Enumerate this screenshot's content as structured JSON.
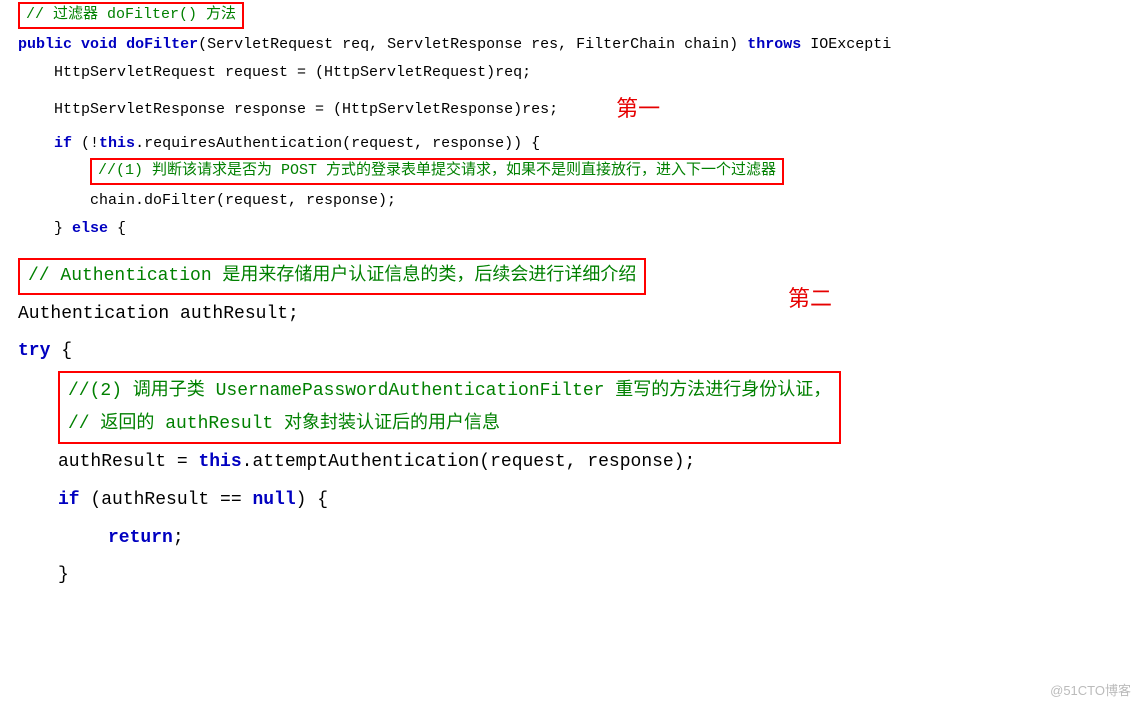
{
  "block1": {
    "c1": "// 过滤器 doFilter() 方法",
    "sig": {
      "pub": "public",
      "void": "void",
      "fn": "doFilter",
      "args": "(ServletRequest req, ServletResponse res, FilterChain chain)",
      "throws": "throws",
      "ex": "IOExcepti"
    },
    "l1a": "HttpServletRequest request = (HttpServletRequest)req;",
    "l1b": "HttpServletResponse response = (HttpServletResponse)res;",
    "annot1": "第一",
    "if1a": "if",
    "if1b": "(!",
    "if1this": "this",
    "if1c": ".requiresAuthentication(request, response)) {",
    "c2": "//(1) 判断该请求是否为 POST 方式的登录表单提交请求，如果不是则直接放行，进入下一个过滤器",
    "chain": "chain.doFilter(request, response);",
    "else1": "} ",
    "elsekw": "else",
    "else2": " {"
  },
  "block2": {
    "c3": "// Authentication 是用来存储用户认证信息的类，后续会进行详细介绍",
    "annot2": "第二",
    "decl": "Authentication authResult;",
    "try": "try",
    "tryb": " {",
    "c4a": "//(2) 调用子类 UsernamePasswordAuthenticationFilter 重写的方法进行身份认证，",
    "c4b": "// 返回的 authResult 对象封装认证后的用户信息",
    "assign1": "authResult = ",
    "assignthis": "this",
    "assign2": ".attemptAuthentication(request, response);",
    "if2a": "if",
    "if2b": " (authResult == ",
    "null": "null",
    "if2c": ") {",
    "ret": "return",
    "retsemi": ";",
    "closebrace": "}"
  },
  "watermark": "@51CTO博客"
}
